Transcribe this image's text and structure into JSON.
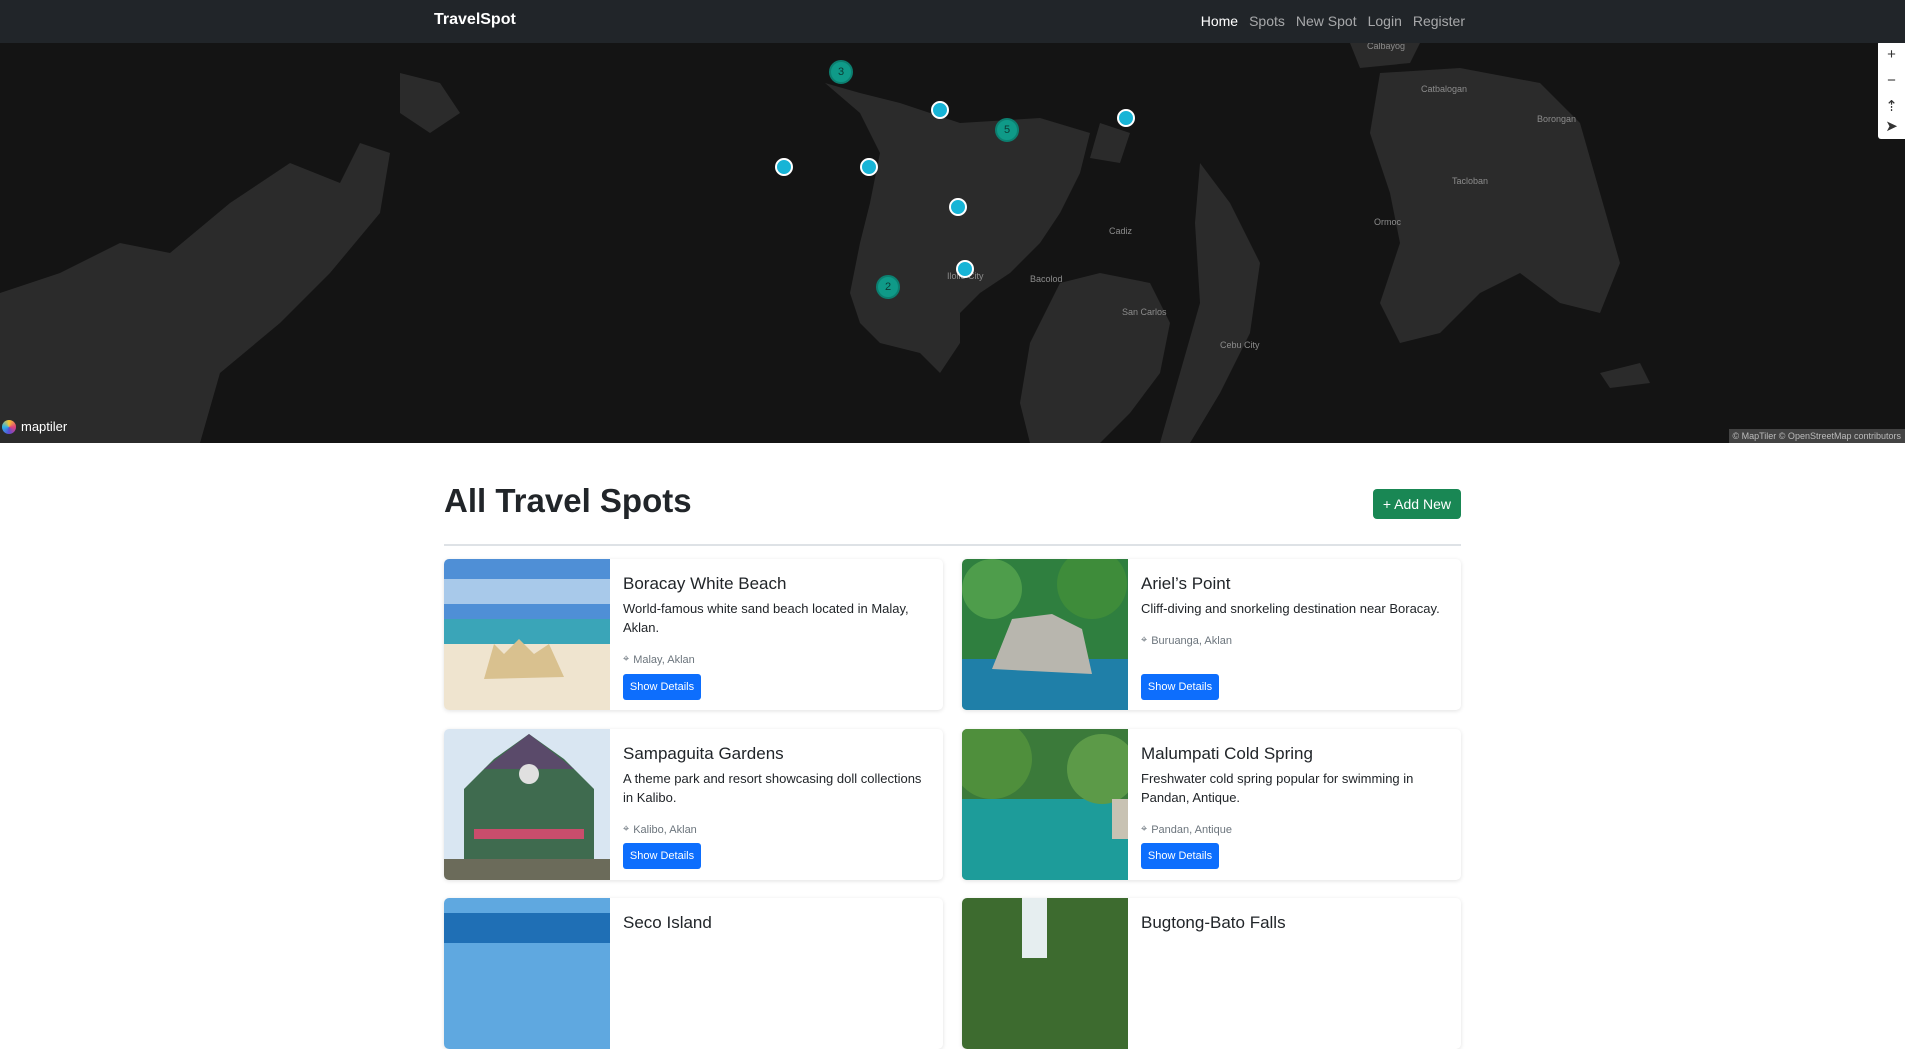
{
  "nav": {
    "brand": "TravelSpot",
    "links": [
      "Home",
      "Spots",
      "New Spot",
      "Login",
      "Register"
    ]
  },
  "map": {
    "cities": [
      "Calbayog",
      "Catbalogan",
      "Borongan",
      "Tacloban",
      "Ormoc",
      "Cadiz",
      "Iloilo City",
      "Bacolod",
      "San Carlos",
      "Cebu City"
    ],
    "clusters": [
      "3",
      "5",
      "2"
    ],
    "logo_text": "maptiler",
    "attribution": "© MapTiler © OpenStreetMap contributors",
    "controls": [
      "+",
      "−",
      "⇡",
      "➤"
    ]
  },
  "page": {
    "title": "All Travel Spots",
    "add_new": "+ Add New"
  },
  "spots": [
    {
      "title": "Boracay White Beach",
      "description": "World-famous white sand beach located in Malay, Aklan.",
      "location": "Malay, Aklan",
      "button": "Show Details"
    },
    {
      "title": "Ariel’s Point",
      "description": "Cliff-diving and snorkeling destination near Boracay.",
      "location": "Buruanga, Aklan",
      "button": "Show Details"
    },
    {
      "title": "Sampaguita Gardens",
      "description": "A theme park and resort showcasing doll collections in Kalibo.",
      "location": "Kalibo, Aklan",
      "button": "Show Details"
    },
    {
      "title": "Malumpati Cold Spring",
      "description": "Freshwater cold spring popular for swimming in Pandan, Antique.",
      "location": "Pandan, Antique",
      "button": "Show Details"
    },
    {
      "title": "Seco Island",
      "description": "",
      "location": "",
      "button": ""
    },
    {
      "title": "Bugtong-Bato Falls",
      "description": "",
      "location": "",
      "button": ""
    }
  ]
}
